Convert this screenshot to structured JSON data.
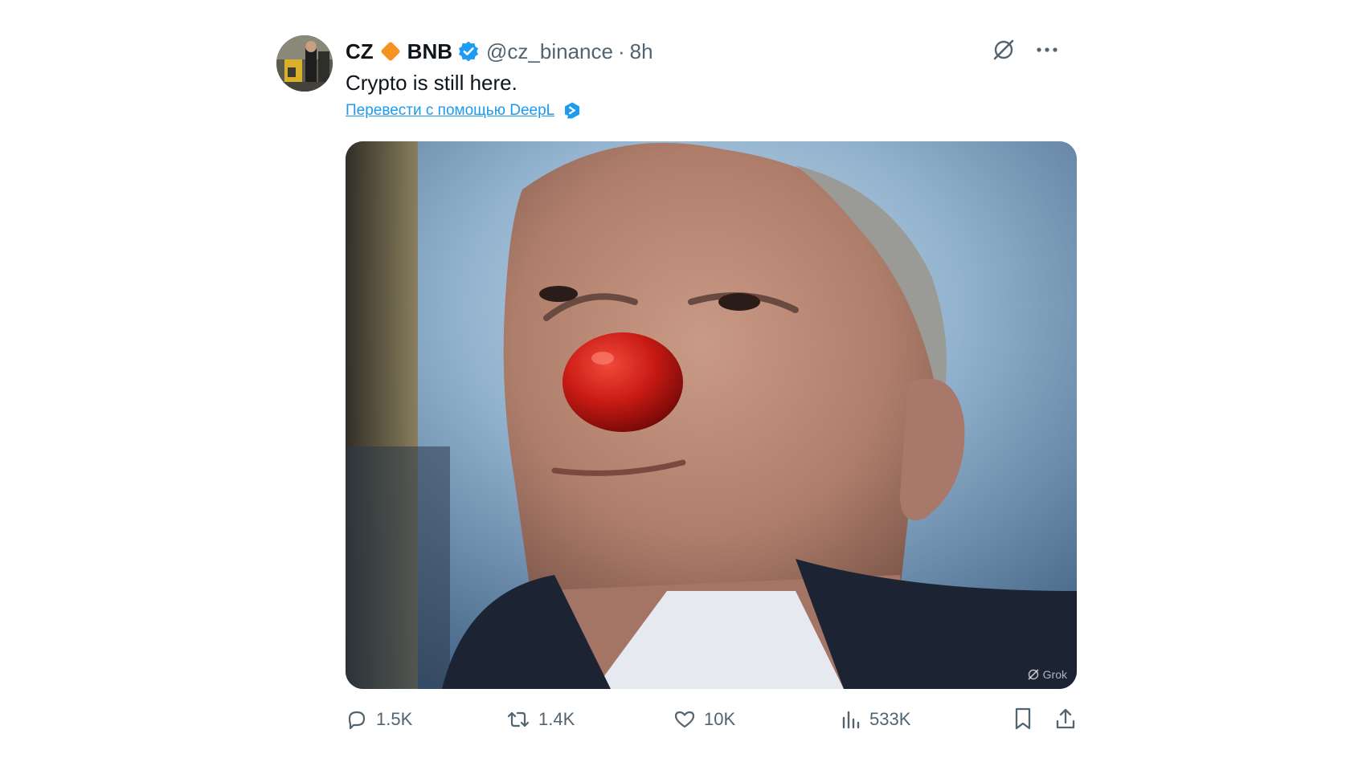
{
  "author": {
    "name": "CZ",
    "affiliation": "BNB",
    "handle": "@cz_binance",
    "separator": "·",
    "time": "8h"
  },
  "tweet": {
    "text": "Crypto is still here.",
    "translate_link": "Перевести с помощью DeepL"
  },
  "media": {
    "watermark": "Grok"
  },
  "actions": {
    "replies": "1.5K",
    "reposts": "1.4K",
    "likes": "10K",
    "views": "533K"
  },
  "icons": {
    "diamond": "bnb-diamond-icon",
    "verified": "verified-badge-icon",
    "grok": "grok-icon",
    "more": "more-icon",
    "reply": "reply-icon",
    "repost": "repost-icon",
    "like": "heart-icon",
    "views": "views-icon",
    "bookmark": "bookmark-icon",
    "share": "share-icon",
    "deepl": "deepl-icon"
  },
  "colors": {
    "link": "#1d9bf0",
    "muted": "#536471",
    "text": "#0f1419",
    "diamond": "#f5931e",
    "verified": "#1d9bf0"
  }
}
